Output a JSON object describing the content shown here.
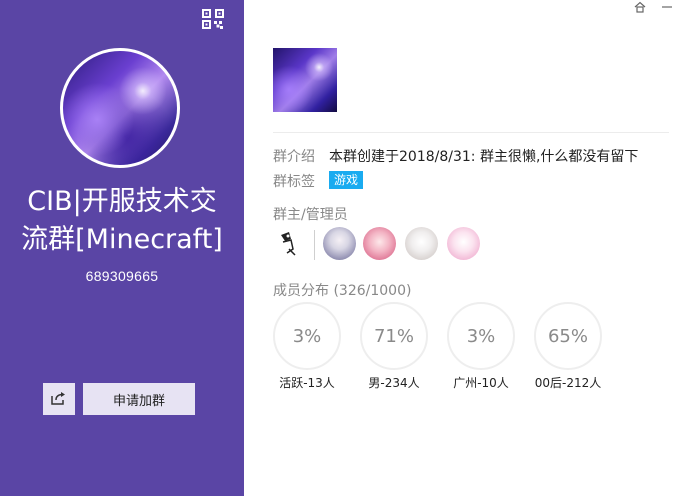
{
  "group": {
    "name": "CIB|开服技术交流群[Minecraft]",
    "name_line1": "CIB|开服技术交",
    "name_line2": "流群[Minecraft]",
    "id": "689309665"
  },
  "actions": {
    "join_label": "申请加群",
    "share_icon": "share-icon"
  },
  "info": {
    "intro_label": "群介绍",
    "intro_text": "本群创建于2018/8/31:  群主很懒,什么都没有留下",
    "tags_label": "群标签",
    "tag": "游戏",
    "admins_label": "群主/管理员"
  },
  "members": {
    "title": "成员分布 (326/1000)",
    "stats": [
      {
        "value": "3%",
        "label": "活跃-13人"
      },
      {
        "value": "71%",
        "label": "男-234人"
      },
      {
        "value": "3%",
        "label": "广州-10人"
      },
      {
        "value": "65%",
        "label": "00后-212人"
      }
    ]
  },
  "colors": {
    "panel": "#5a45a5",
    "tag": "#1aabf0"
  }
}
